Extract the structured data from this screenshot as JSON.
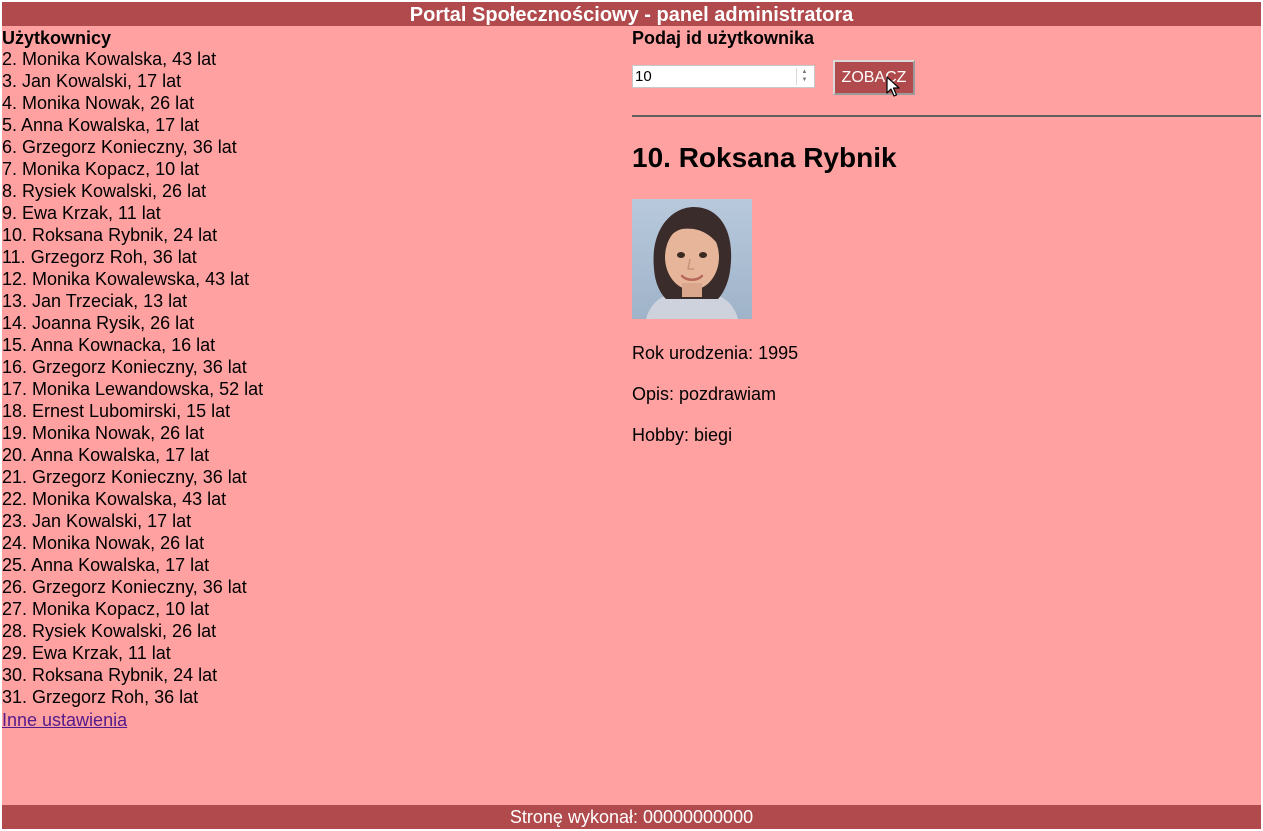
{
  "header": {
    "title": "Portal Społecznościowy - panel administratora"
  },
  "users_panel": {
    "title": "Użytkownicy",
    "users": [
      "2. Monika Kowalska, 43 lat",
      "3. Jan Kowalski, 17 lat",
      "4. Monika Nowak, 26 lat",
      "5. Anna Kowalska, 17 lat",
      "6. Grzegorz Konieczny, 36 lat",
      "7. Monika Kopacz, 10 lat",
      "8. Rysiek Kowalski, 26 lat",
      "9. Ewa Krzak, 11 lat",
      "10. Roksana Rybnik, 24 lat",
      "11. Grzegorz Roh, 36 lat",
      "12. Monika Kowalewska, 43 lat",
      "13. Jan Trzeciak, 13 lat",
      "14. Joanna Rysik, 26 lat",
      "15. Anna Kownacka, 16 lat",
      "16. Grzegorz Konieczny, 36 lat",
      "17. Monika Lewandowska, 52 lat",
      "18. Ernest Lubomirski, 15 lat",
      "19. Monika Nowak, 26 lat",
      "20. Anna Kowalska, 17 lat",
      "21. Grzegorz Konieczny, 36 lat",
      "22. Monika Kowalska, 43 lat",
      "23. Jan Kowalski, 17 lat",
      "24. Monika Nowak, 26 lat",
      "25. Anna Kowalska, 17 lat",
      "26. Grzegorz Konieczny, 36 lat",
      "27. Monika Kopacz, 10 lat",
      "28. Rysiek Kowalski, 26 lat",
      "29. Ewa Krzak, 11 lat",
      "30. Roksana Rybnik, 24 lat",
      "31. Grzegorz Roh, 36 lat"
    ],
    "settings_link": "Inne ustawienia"
  },
  "lookup": {
    "title": "Podaj id użytkownika",
    "id_value": "10",
    "button_label": "ZOBACZ"
  },
  "profile": {
    "name": "10. Roksana Rybnik",
    "birth_year": "Rok urodzenia: 1995",
    "description": "Opis: pozdrawiam",
    "hobby": "Hobby: biegi"
  },
  "footer": {
    "text": "Stronę wykonał: 00000000000"
  },
  "icons": {
    "spin_up": "spin-up-arrow-icon",
    "spin_down": "spin-down-arrow-icon",
    "cursor": "mouse-pointer-icon"
  },
  "colors": {
    "header_bg": "#b04a4c",
    "main_bg": "#ffa1a1",
    "link": "#551a8b"
  }
}
